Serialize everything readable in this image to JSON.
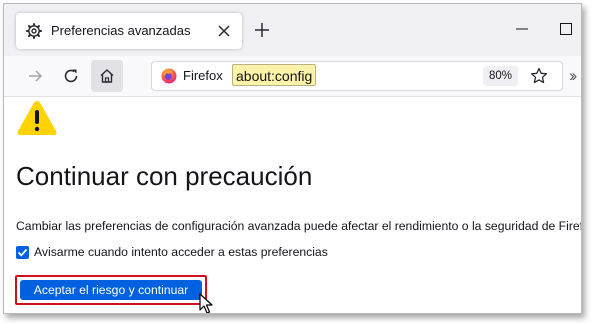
{
  "tab": {
    "title": "Preferencias avanzadas",
    "icon": "gear-icon"
  },
  "toolbar": {
    "site_label": "Firefox",
    "url": "about:config",
    "zoom": "80%"
  },
  "content": {
    "heading": "Continuar con precaución",
    "description": "Cambiar las preferencias de configuración avanzada puede afectar el rendimiento o la seguridad de Firefox.",
    "checkbox_label": "Avisarme cuando intento acceder a estas preferencias",
    "checkbox_checked": true,
    "accept_button": "Aceptar el riesgo y continuar"
  },
  "colors": {
    "accent": "#0061e0",
    "warning": "#ffd200",
    "highlight_outline": "#d0101c",
    "url_highlight": "#fbf4a8"
  }
}
